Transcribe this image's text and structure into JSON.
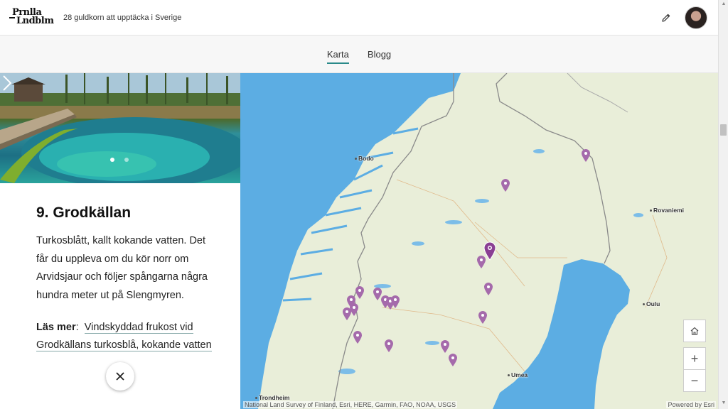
{
  "header": {
    "logo": {
      "line1": "Prnlla",
      "line2": "Lndblm"
    },
    "title": "28 guldkorn att upptäcka i Sverige",
    "edit_icon": "pencil-icon",
    "avatar": "user-avatar"
  },
  "nav": {
    "tabs": [
      {
        "label": "Karta",
        "active": true
      },
      {
        "label": "Blogg",
        "active": false
      }
    ]
  },
  "story": {
    "heading": "9. Grodkällan",
    "body": "Turkosblått, kallt kokande vatten. Det får du uppleva om du kör norr om Arvidsjaur och följer spångarna några hundra meter ut på Slengmyren.",
    "readmore_label": "Läs mer",
    "readmore_colon": ":",
    "readmore_link": "Vindskyddad frukost vid Grodkällans turkosblå, kokande vatten",
    "carousel": {
      "slides": 2,
      "current": 1,
      "next_icon": "chevron-right-icon"
    },
    "close_icon": "close-icon"
  },
  "map": {
    "cities": [
      "Bodo",
      "Rovaniemi",
      "Oulu",
      "Umea",
      "Trondheim"
    ],
    "attribution": "National Land Survey of Finland, Esri, HERE, Garmin, FAO, NOAA, USGS",
    "powered_by": "Powered by Esri",
    "controls": {
      "home_icon": "home-icon",
      "zoom_in": "+",
      "zoom_out": "−"
    },
    "marker_color": "#a56aab",
    "marker_selected_color": "#8a3f93"
  },
  "colors": {
    "accent": "#2a8a8a",
    "water": "#5cade3",
    "land": "#e8eed8"
  }
}
